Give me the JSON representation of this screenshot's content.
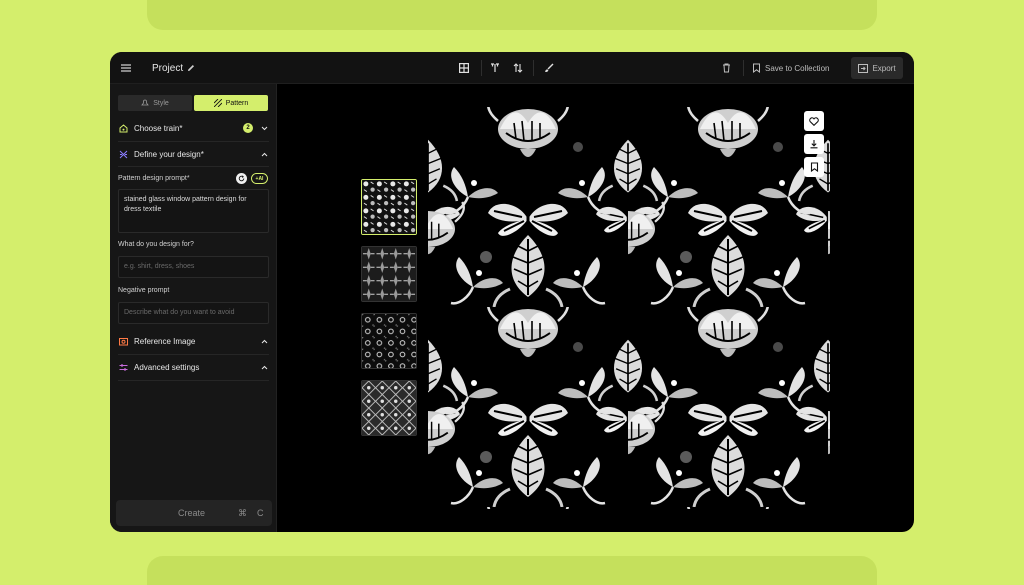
{
  "topbar": {
    "project_title": "Project",
    "save_label": "Save to Collection",
    "export_label": "Export"
  },
  "sidebar": {
    "tabs": [
      {
        "label": "Style",
        "active": false
      },
      {
        "label": "Pattern",
        "active": true
      }
    ],
    "choose_train": {
      "label": "Choose train*",
      "count": "2"
    },
    "define_design": {
      "label": "Define your design*"
    },
    "prompt": {
      "label": "Pattern design prompt*",
      "value": "stained glass window pattern design for dress textile",
      "ai_label": "+AI"
    },
    "design_for": {
      "label": "What do you design for?",
      "placeholder": "e.g. shirt, dress, shoes"
    },
    "negative": {
      "label": "Negative prompt",
      "placeholder": "Describe what do you want to avoid"
    },
    "reference": {
      "label": "Reference Image"
    },
    "advanced": {
      "label": "Advanced settings"
    },
    "create": {
      "label": "Create",
      "key1": "⌘",
      "key2": "C"
    }
  },
  "colors": {
    "accent": "#d4ee6c",
    "background": "#000000",
    "panel": "#161616"
  }
}
